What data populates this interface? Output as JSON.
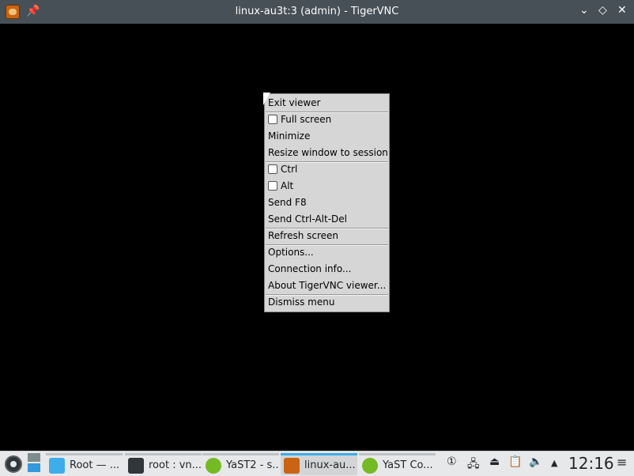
{
  "window": {
    "title": "linux-au3t:3 (admin) - TigerVNC",
    "pin_glyph": "📌",
    "controls": {
      "minimize": "⌄",
      "maximize": "◇",
      "close": "✕"
    }
  },
  "menu": {
    "items": [
      {
        "label": "Exit viewer",
        "checkbox": false
      },
      {
        "label": "Full screen",
        "checkbox": true,
        "checked": false
      },
      {
        "label": "Minimize",
        "checkbox": false
      },
      {
        "label": "Resize window to session",
        "checkbox": false
      },
      {
        "label": "Ctrl",
        "checkbox": true,
        "checked": false
      },
      {
        "label": "Alt",
        "checkbox": true,
        "checked": false
      },
      {
        "label": "Send F8",
        "checkbox": false
      },
      {
        "label": "Send Ctrl-Alt-Del",
        "checkbox": false
      },
      {
        "label": "Refresh screen",
        "checkbox": false
      },
      {
        "label": "Options...",
        "checkbox": false
      },
      {
        "label": "Connection info...",
        "checkbox": false
      },
      {
        "label": "About TigerVNC viewer...",
        "checkbox": false
      },
      {
        "label": "Dismiss menu",
        "checkbox": false
      }
    ]
  },
  "taskbar": {
    "tasks": [
      {
        "label": "Root — ...",
        "icon": "folder-icon",
        "color": "#3daee9"
      },
      {
        "label": "root : vn...",
        "icon": "terminal-icon",
        "color": "#31363b"
      },
      {
        "label": "YaST2 - s...",
        "icon": "yast-icon",
        "color": "#73ba25"
      },
      {
        "label": "linux-au...",
        "icon": "tigervnc-icon",
        "color": "#c86412",
        "active": true
      },
      {
        "label": "YaST Co...",
        "icon": "yast-icon",
        "color": "#73ba25"
      }
    ],
    "tray": {
      "notifications": "①",
      "network": "🖧",
      "usb": "⏏",
      "clipboard": "📋",
      "volume": "🔈",
      "expand": "▲"
    },
    "clock": "12:16",
    "menu_glyph": "≡"
  }
}
